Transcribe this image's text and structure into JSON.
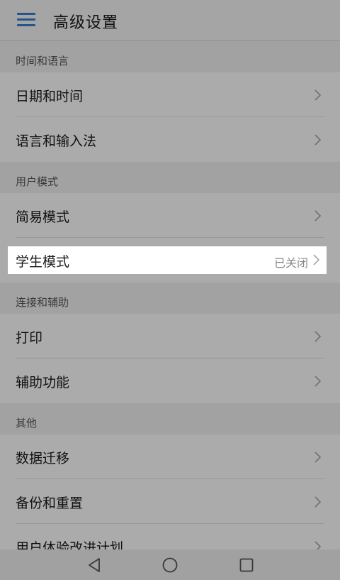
{
  "header": {
    "title": "高级设置",
    "menu_icon": "hamburger-menu-icon",
    "accent_color": "#3a7fd0"
  },
  "sections": [
    {
      "title": "时间和语言",
      "items": [
        {
          "label": "日期和时间"
        },
        {
          "label": "语言和输入法"
        }
      ]
    },
    {
      "title": "用户模式",
      "items": [
        {
          "label": "简易模式"
        },
        {
          "label": "学生模式",
          "value": "已关闭",
          "highlighted": true
        }
      ]
    },
    {
      "title": "连接和辅助",
      "items": [
        {
          "label": "打印"
        },
        {
          "label": "辅助功能"
        }
      ]
    },
    {
      "title": "其他",
      "items": [
        {
          "label": "数据迁移"
        },
        {
          "label": "备份和重置"
        },
        {
          "label": "用户体验改进计划"
        }
      ]
    }
  ],
  "navbar": {
    "back_icon": "back-triangle-icon",
    "home_icon": "home-circle-icon",
    "recents_icon": "recents-square-icon"
  }
}
